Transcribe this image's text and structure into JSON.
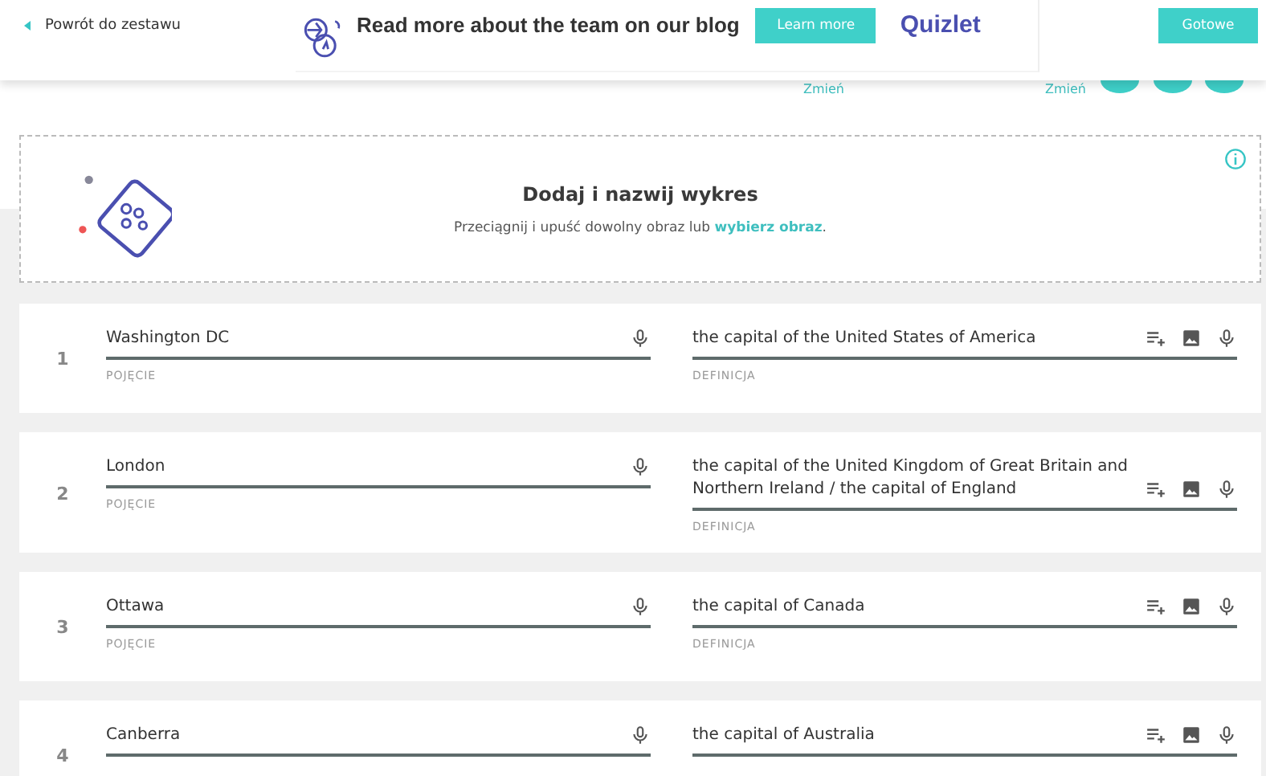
{
  "header": {
    "back_link": "Powrót do zestawu",
    "ad": {
      "headline": "Read more about the team on our blog",
      "button": "Learn more",
      "brand": "Quizlet"
    },
    "done_button": "Gotowe"
  },
  "settings": {
    "links": [
      "Zmień",
      "Zmień"
    ]
  },
  "diagram": {
    "title": "Dodaj i nazwij wykres",
    "text": "Przeciągnij i upuść dowolny obraz lub ",
    "link": "wybierz obraz",
    "after": "."
  },
  "cards": [
    {
      "number": "1",
      "term": "Washington DC",
      "term_label": "POJĘCIE",
      "definition": "the capital of the United States of America",
      "definition_label": "DEFINICJA"
    },
    {
      "number": "2",
      "term": "London",
      "term_label": "POJĘCIE",
      "definition": "the capital of the United Kingdom of Great Britain and Northern Ireland / the capital of England",
      "definition_label": "DEFINICJA"
    },
    {
      "number": "3",
      "term": "Ottawa",
      "term_label": "POJĘCIE",
      "definition": "the capital of Canada",
      "definition_label": "DEFINICJA"
    },
    {
      "number": "4",
      "term": "Canberra",
      "definition": "the capital of Australia"
    }
  ]
}
